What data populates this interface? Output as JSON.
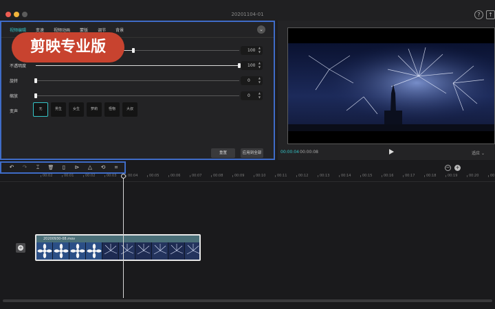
{
  "window": {
    "title": "20201104-01"
  },
  "colors": {
    "accent": "#35c6c9",
    "highlight_border": "#3f6cc8",
    "banner": "#c8432f"
  },
  "banner": {
    "text": "剪映专业版"
  },
  "editor": {
    "tabs": [
      "视频编辑",
      "变速",
      "视频动画",
      "蒙版",
      "调节",
      "背景"
    ],
    "active_tab": "视频编辑",
    "rows": [
      {
        "label": "",
        "value": "100",
        "level": 0.48
      },
      {
        "label": "不透明度",
        "value": "100",
        "level": 1.0
      },
      {
        "label": "旋转",
        "value": "0",
        "level": 0.0
      },
      {
        "label": "缩放",
        "value": "0",
        "level": 0.0
      }
    ],
    "voice_label": "变声",
    "voice_options": [
      "无",
      "男生",
      "女生",
      "萝莉",
      "怪物",
      "大叔"
    ],
    "voice_selected": "无",
    "reset_label": "重置",
    "apply_all_label": "应用到全部"
  },
  "preview": {
    "current_time": "00:00:04",
    "total_time": "00:00:08",
    "ratio_label": "适应"
  },
  "toolbar": {
    "tools": [
      "undo-icon",
      "redo-icon",
      "split-icon",
      "delete-icon",
      "freeze-icon",
      "play-speed-icon",
      "mirror-icon",
      "rotate-icon",
      "crop-icon"
    ],
    "tool_glyphs": [
      "↶",
      "↷",
      "⌶",
      "🗑",
      "▯",
      "⊳",
      "△",
      "⟲",
      "⌗"
    ]
  },
  "timeline": {
    "ticks": [
      "00:02",
      "00:01",
      "00:02",
      "00:03",
      "00:04",
      "00:05",
      "00:06",
      "00:07",
      "00:08",
      "00:09",
      "00:10",
      "00:11",
      "00:12",
      "00:13",
      "00:14",
      "00:15",
      "00:16",
      "00:17",
      "00:18",
      "00:19",
      "00:20",
      "00:21"
    ],
    "clip_name": "20200930-08.mov"
  }
}
